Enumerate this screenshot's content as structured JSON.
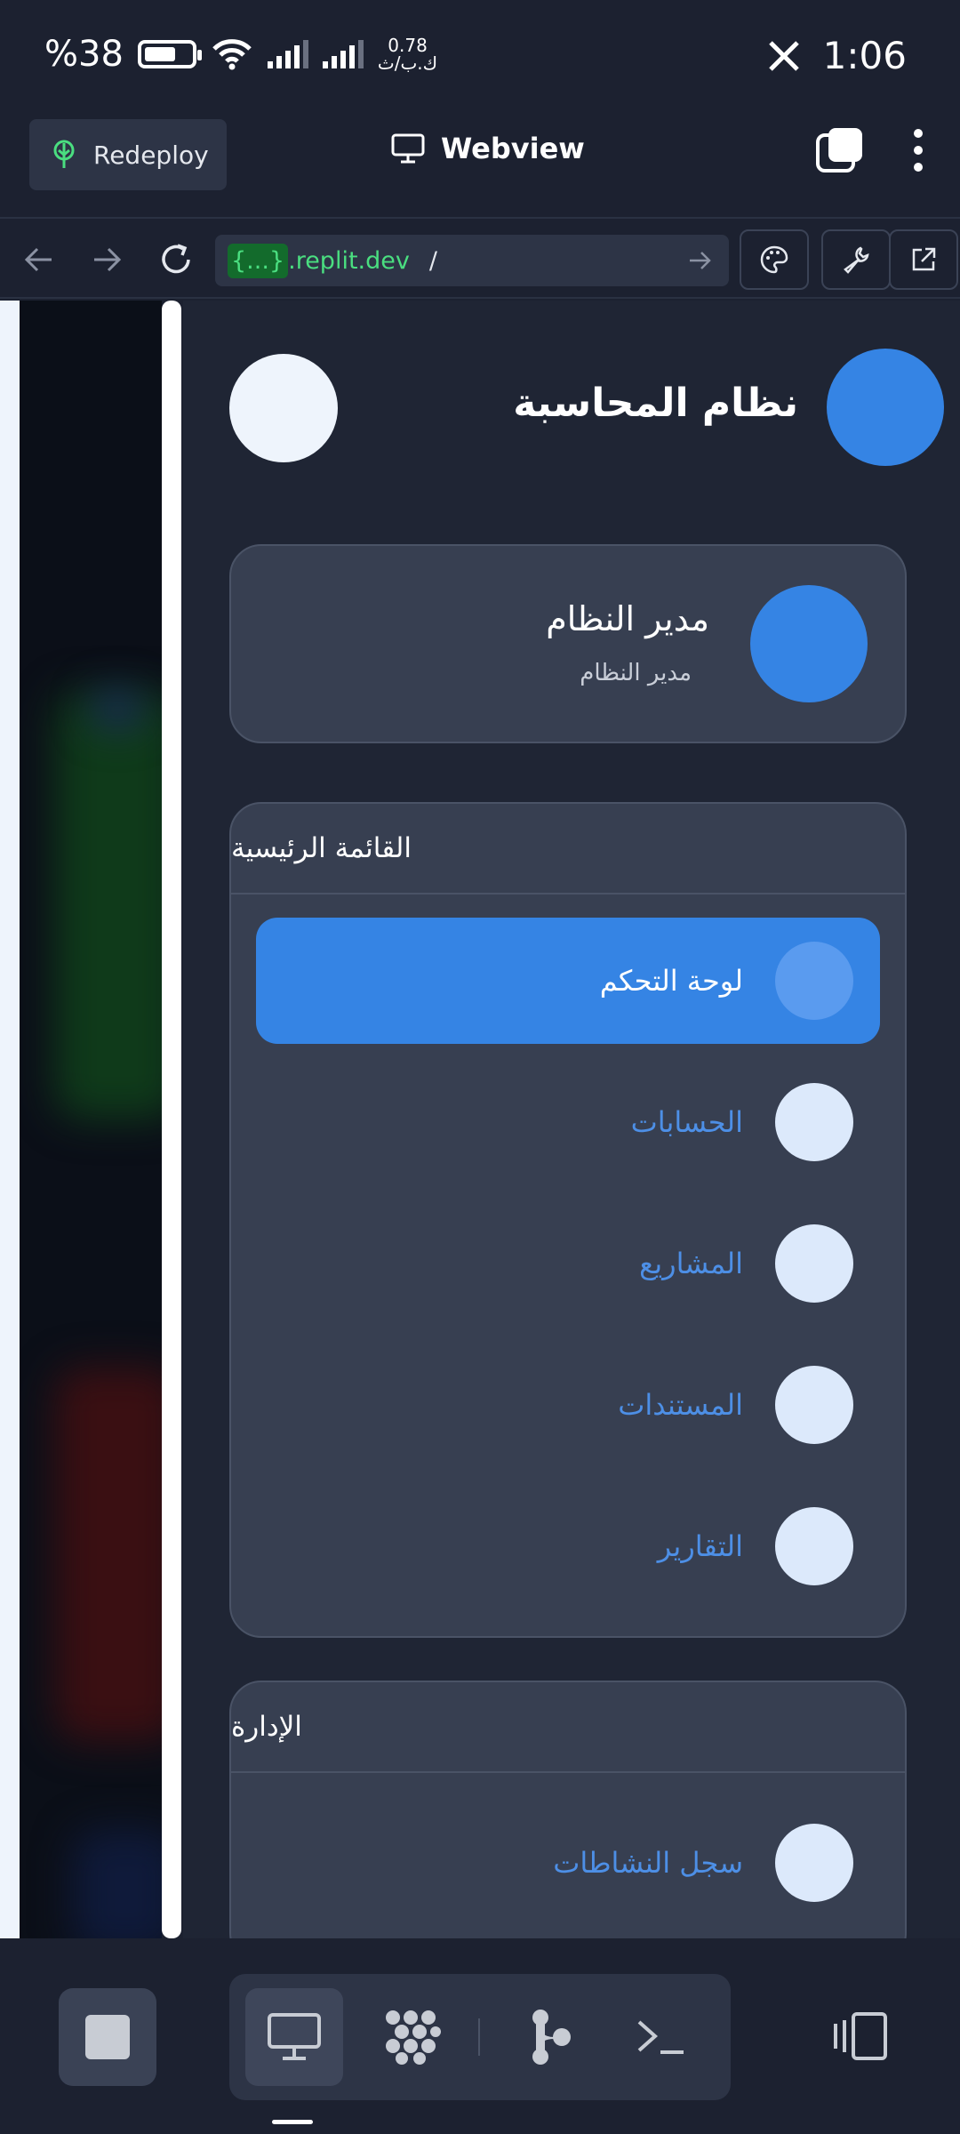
{
  "status_bar": {
    "battery": "%38",
    "net_speed_value": "0.78",
    "net_speed_unit": "ك.ب/ث",
    "time": "1:06"
  },
  "top_bar": {
    "redeploy_label": "Redeploy",
    "title": "Webview"
  },
  "url_bar": {
    "brace": "{...}",
    "host": ".replit.dev",
    "path": "/"
  },
  "app": {
    "title": "نظام المحاسبة",
    "user": {
      "name": "مدير النظام",
      "role": "مدير النظام"
    },
    "main_menu": {
      "heading": "القائمة الرئيسية",
      "items": [
        {
          "label": "لوحة التحكم",
          "active": true
        },
        {
          "label": "الحسابات",
          "active": false
        },
        {
          "label": "المشاريع",
          "active": false
        },
        {
          "label": "المستندات",
          "active": false
        },
        {
          "label": "التقارير",
          "active": false
        }
      ]
    },
    "admin_menu": {
      "heading": "الإدارة",
      "items": [
        {
          "label": "سجل النشاطات",
          "active": false
        }
      ]
    }
  },
  "colors": {
    "accent": "#3584e4",
    "background": "#1c2130",
    "card": "#373f51",
    "url_green": "#4ade80"
  }
}
